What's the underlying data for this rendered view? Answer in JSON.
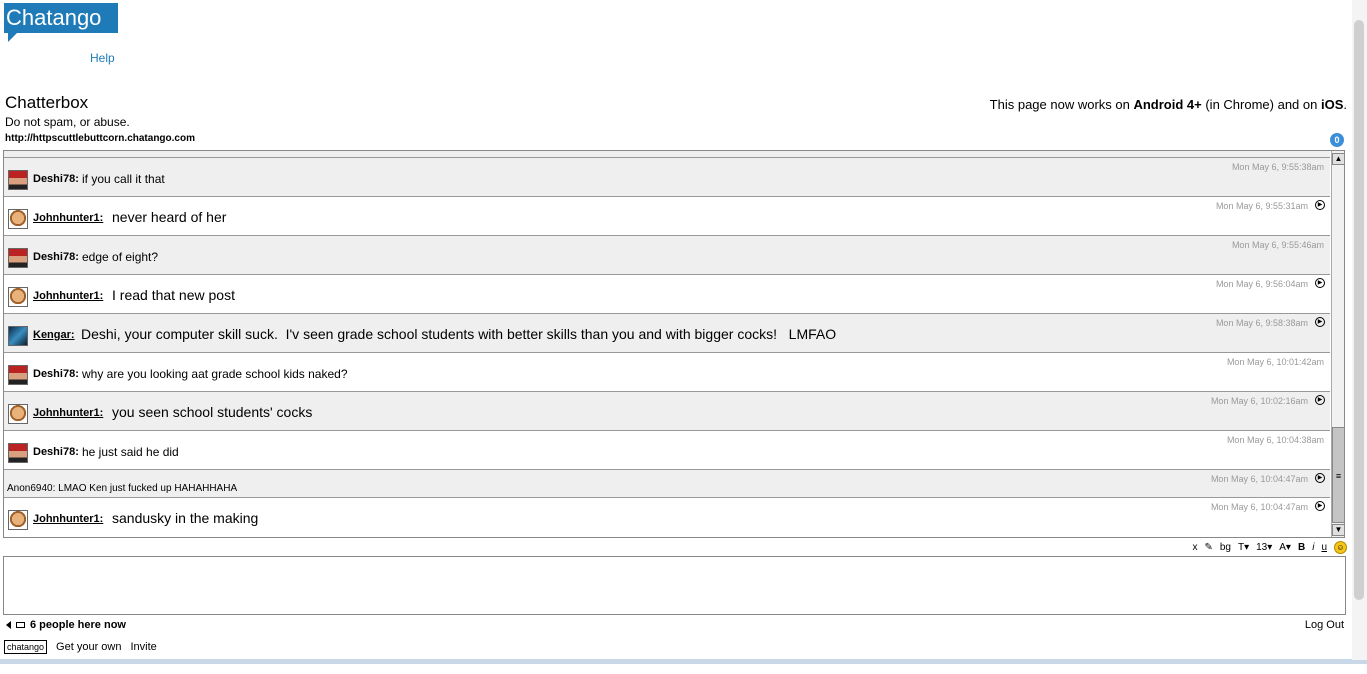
{
  "header": {
    "logo_text": "Chatango",
    "help_label": "Help",
    "title": "Chatterbox",
    "subtitle": "Do not spam, or abuse.",
    "url": "http://httpscuttlebuttcorn.chatango.com",
    "notice_prefix": "This page now works on ",
    "notice_android": "Android 4+",
    "notice_mid": " (in Chrome) and on ",
    "notice_ios": "iOS",
    "notice_end": ".",
    "badge_count": "0"
  },
  "messages": [
    {
      "user": "Deshi78:",
      "text": "if you call it that",
      "time": "Mon May 6, 9:55:38am"
    },
    {
      "user": "Johnhunter1:",
      "text": "never heard of her",
      "time": "Mon May 6, 9:55:31am"
    },
    {
      "user": "Deshi78:",
      "text": "edge of eight?",
      "time": "Mon May 6, 9:55:46am"
    },
    {
      "user": "Johnhunter1:",
      "text": "I read that new post",
      "time": "Mon May 6, 9:56:04am"
    },
    {
      "user": "Kengar:",
      "text": "Deshi, your computer skill suck.  I'v seen grade school students with better skills than you and with bigger cocks!   LMFAO",
      "time": "Mon May 6, 9:58:38am"
    },
    {
      "user": "Deshi78:",
      "text": "why are you looking aat grade school kids naked?",
      "time": "Mon May 6, 10:01:42am"
    },
    {
      "user": "Johnhunter1:",
      "text": "you seen school students' cocks",
      "time": "Mon May 6, 10:02:16am"
    },
    {
      "user": "Deshi78:",
      "text": "he just said he did",
      "time": "Mon May 6, 10:04:38am"
    },
    {
      "anon_text": "Anon6940: LMAO Ken just fucked up HAHAHHAHA",
      "time": "Mon May 6, 10:04:47am"
    },
    {
      "user": "Johnhunter1:",
      "text": "sandusky in the making",
      "time": "Mon May 6, 10:04:47am"
    }
  ],
  "toolbar": {
    "clear": "x",
    "bg": "bg",
    "font": "T▾",
    "size": "13▾",
    "bold": "B",
    "italic": "i",
    "underline": "u"
  },
  "footer": {
    "people": "6 people here now",
    "logout": "Log Out",
    "mini_logo": "chatango",
    "get_own": "Get your own",
    "invite": "Invite"
  },
  "colors": {
    "brand": "#1e7bb8",
    "row_gray": "#efefef",
    "timestamp": "#999999"
  }
}
